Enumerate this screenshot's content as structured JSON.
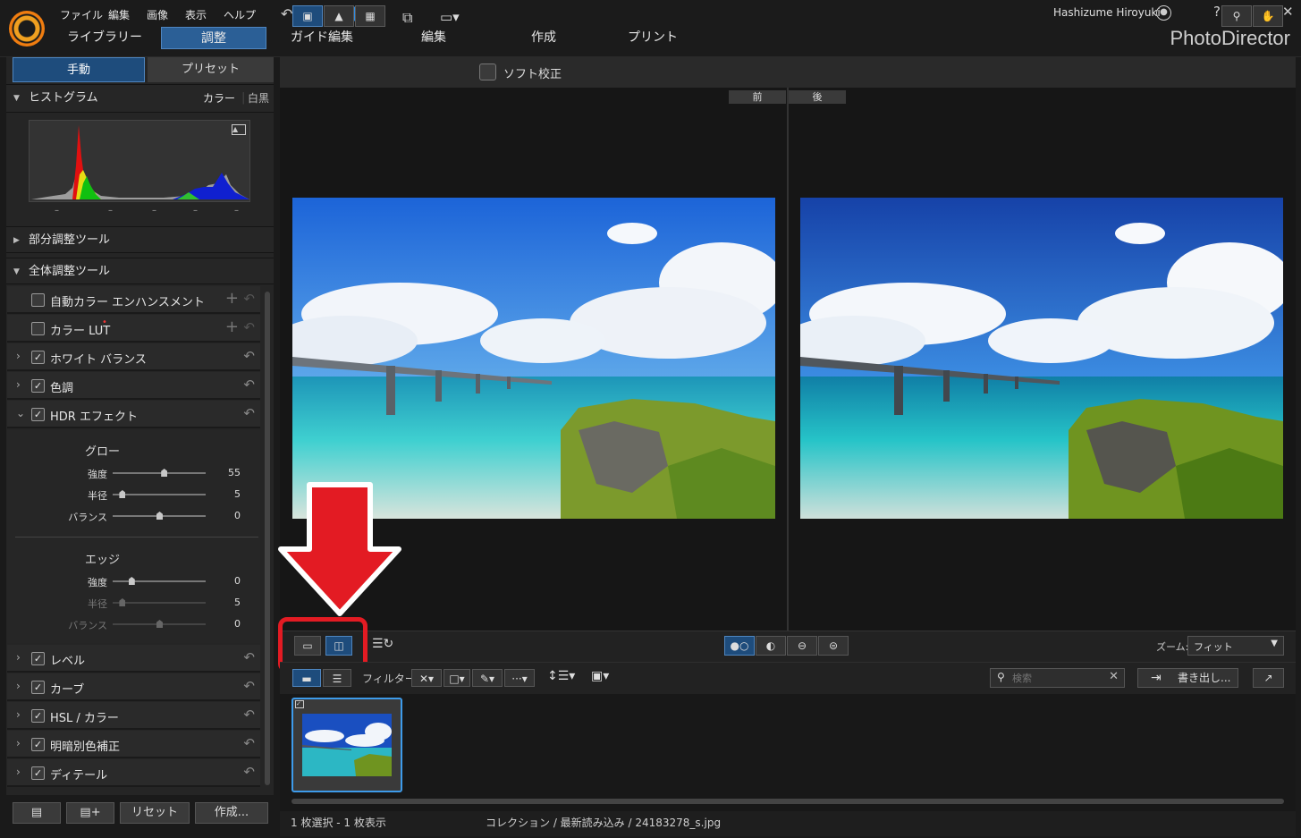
{
  "menu": [
    "ファイル",
    "編集",
    "画像",
    "表示",
    "ヘルプ"
  ],
  "modes": [
    "ライブラリー",
    "調整",
    "ガイド編集",
    "編集",
    "作成",
    "プリント"
  ],
  "brand": "PhotoDirector",
  "user": "Hashizume Hiroyuki",
  "window_buttons": [
    "?",
    "_",
    "☐",
    "✕"
  ],
  "left": {
    "tabs": [
      "手動",
      "プリセット"
    ],
    "histogram": {
      "label": "ヒストグラム",
      "color": "カラー",
      "mono": "白黒",
      "ticks": [
        "–",
        "–",
        "–",
        "–",
        "–"
      ]
    },
    "sections": [
      "部分調整ツール",
      "全体調整ツール"
    ],
    "rows": [
      "自動カラー エンハンスメント",
      "カラー LUT",
      "ホワイト バランス",
      "色調",
      "HDR エフェクト",
      "レベル",
      "カーブ",
      "HSL / カラー",
      "明暗別色補正",
      "ディテール"
    ],
    "glow": {
      "title": "グロー",
      "sliders": [
        {
          "label": "強度",
          "value": "55",
          "level": 0.55
        },
        {
          "label": "半径",
          "value": "5",
          "level": 0.1
        },
        {
          "label": "バランス",
          "value": "0",
          "level": 0.5
        }
      ]
    },
    "edge": {
      "title": "エッジ",
      "sliders": [
        {
          "label": "強度",
          "value": "0",
          "level": 0.2
        },
        {
          "label": "半径",
          "value": "5",
          "level": 0.1
        },
        {
          "label": "バランス",
          "value": "0",
          "level": 0.5
        }
      ]
    },
    "bottom_buttons": [
      "リセット",
      "作成..."
    ]
  },
  "toolbar": {
    "soft_proof": "ソフト校正"
  },
  "viewer": {
    "before": "前",
    "after": "後"
  },
  "zoom": {
    "label": "ズーム:",
    "value": "フィット"
  },
  "filter": {
    "label": "フィルター:"
  },
  "search": {
    "placeholder": "検索"
  },
  "export_label": "書き出し...",
  "status": {
    "selection": "1 枚選択 - 1 枚表示",
    "path": "コレクション / 最新読み込み / 24183278_s.jpg"
  },
  "colors": {
    "accent": "#2b5f96",
    "highlight": "#3e9bea",
    "annotation": "#e31b23"
  },
  "icons": [
    "search-icon",
    "hand-icon",
    "undo-icon",
    "redo-icon",
    "gear-icon",
    "bell-icon",
    "user-icon",
    "sort-icon",
    "export-icon"
  ]
}
